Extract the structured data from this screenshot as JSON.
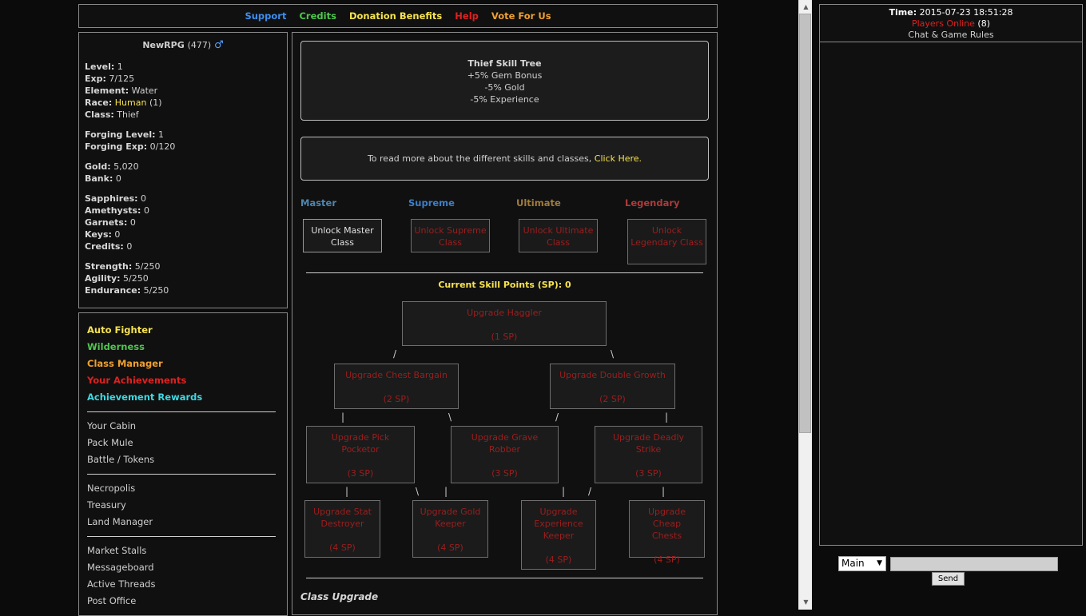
{
  "nav": {
    "links": [
      {
        "label": "Support",
        "color": "#3d8ef0"
      },
      {
        "label": "Credits",
        "color": "#4fc54f"
      },
      {
        "label": "Donation Benefits",
        "color": "#f7e34f"
      },
      {
        "label": "Help",
        "color": "#e02020"
      },
      {
        "label": "Vote For Us",
        "color": "#f0a030"
      }
    ]
  },
  "player": {
    "name": "NewRPG",
    "level_tag": "(477)",
    "gender_symbol": "♂",
    "level_label": "Level:",
    "level": "1",
    "exp_label": "Exp:",
    "exp": "7/125",
    "element_label": "Element:",
    "element": "Water",
    "race_label": "Race:",
    "race": "Human",
    "race_count": "(1)",
    "class_label": "Class:",
    "class": "Thief",
    "forging_level_label": "Forging Level:",
    "forging_level": "1",
    "forging_exp_label": "Forging Exp:",
    "forging_exp": "0/120",
    "gold_label": "Gold:",
    "gold": "5,020",
    "bank_label": "Bank:",
    "bank": "0",
    "sapphires_label": "Sapphires:",
    "sapphires": "0",
    "amethysts_label": "Amethysts:",
    "amethysts": "0",
    "garnets_label": "Garnets:",
    "garnets": "0",
    "keys_label": "Keys:",
    "keys": "0",
    "credits_label": "Credits:",
    "credits": "0",
    "strength_label": "Strength:",
    "strength": "5/250",
    "agility_label": "Agility:",
    "agility": "5/250",
    "endurance_label": "Endurance:",
    "endurance": "5/250"
  },
  "menu": {
    "highlight": [
      {
        "label": "Auto Fighter",
        "color": "#f7e34f"
      },
      {
        "label": "Wilderness",
        "color": "#4fc54f"
      },
      {
        "label": "Class Manager",
        "color": "#f0a030"
      },
      {
        "label": "Your Achievements",
        "color": "#e02020"
      },
      {
        "label": "Achievement Rewards",
        "color": "#3fd8e0"
      }
    ],
    "group1": [
      "Your Cabin",
      "Pack Mule",
      "Battle / Tokens"
    ],
    "group2": [
      "Necropolis",
      "Treasury",
      "Land Manager"
    ],
    "group3": [
      "Market Stalls",
      "Messageboard",
      "Active Threads",
      "Post Office"
    ]
  },
  "skilltree": {
    "title": "Thief Skill Tree",
    "bonus1": "+5% Gem Bonus",
    "bonus2": "-5% Gold",
    "bonus3": "-5% Experience",
    "readmore_text": "To read more about the different skills and classes, ",
    "readmore_link": "Click Here.",
    "tiers": [
      {
        "label": "Master",
        "color": "#4e86b0",
        "button": "Unlock Master Class",
        "enabled": true
      },
      {
        "label": "Supreme",
        "color": "#3d7fc8",
        "button": "Unlock Supreme Class",
        "enabled": false
      },
      {
        "label": "Ultimate",
        "color": "#a07c3c",
        "button": "Unlock Ultimate Class",
        "enabled": false
      },
      {
        "label": "Legendary",
        "color": "#b03a3a",
        "button": "Unlock Legendary Class",
        "enabled": false
      }
    ],
    "sp_label": "Current Skill Points (SP): 0",
    "nodes": {
      "haggler": {
        "name": "Upgrade Haggler",
        "cost": "(1 SP)"
      },
      "chest": {
        "name": "Upgrade Chest Bargain",
        "cost": "(2 SP)"
      },
      "double": {
        "name": "Upgrade Double Growth",
        "cost": "(2 SP)"
      },
      "pick": {
        "name": "Upgrade Pick Pocketor",
        "cost": "(3 SP)"
      },
      "grave": {
        "name": "Upgrade Grave Robber",
        "cost": "(3 SP)"
      },
      "deadly": {
        "name": "Upgrade Deadly Strike",
        "cost": "(3 SP)"
      },
      "stat": {
        "name": "Upgrade Stat Destroyer",
        "cost": "(4 SP)"
      },
      "gold": {
        "name": "Upgrade Gold Keeper",
        "cost": "(4 SP)"
      },
      "exp": {
        "name": "Upgrade Experience Keeper",
        "cost": "(4 SP)"
      },
      "cheap": {
        "name": "Upgrade Cheap Chests",
        "cost": "(4 SP)"
      }
    },
    "class_upgrade": "Class Upgrade"
  },
  "chat": {
    "time_label": "Time:",
    "time": "2015-07-23 18:51:28",
    "players_online": "Players Online",
    "players_count": "(8)",
    "rules": "Chat & Game Rules",
    "channel": "Main",
    "send": "Send"
  }
}
